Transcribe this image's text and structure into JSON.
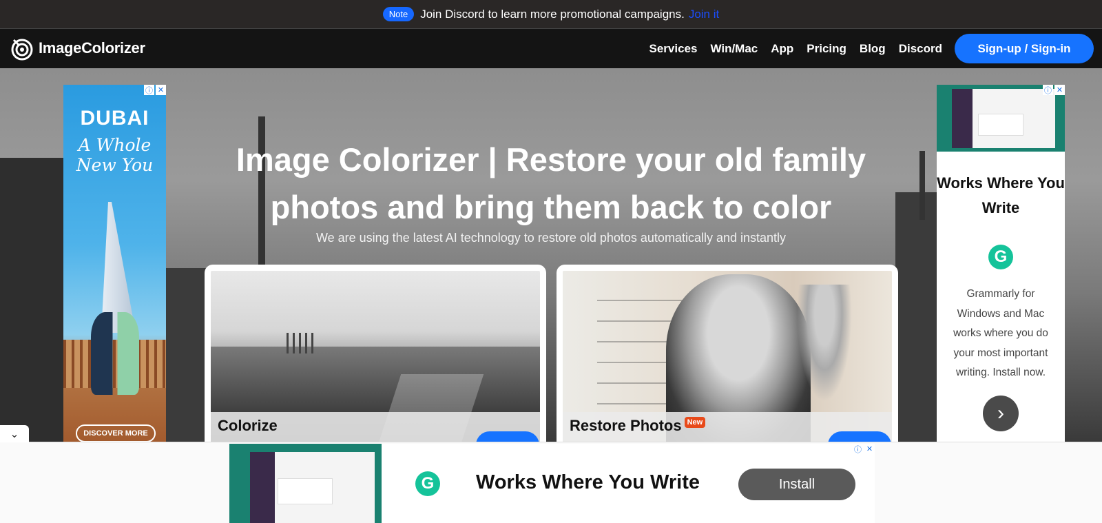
{
  "notice": {
    "badge": "Note",
    "text": "Join Discord to learn more promotional campaigns.",
    "link": "Join it"
  },
  "navbar": {
    "brand": "ImageColorizer",
    "links": [
      "Services",
      "Win/Mac",
      "App",
      "Pricing",
      "Blog",
      "Discord"
    ],
    "signin": "Sign-up / Sign-in"
  },
  "hero": {
    "title": "Image Colorizer | Restore your old family photos and bring them back to color",
    "subtitle": "We are using the latest AI technology to restore old photos automatically and instantly",
    "cards": [
      {
        "label": "Colorize",
        "badge": ""
      },
      {
        "label": "Restore Photos",
        "badge": "New"
      }
    ]
  },
  "ad_left": {
    "brand": "DUBAI",
    "tagline": "A Whole New You",
    "cta": "DISCOVER MORE"
  },
  "ad_right": {
    "title": "Works Where You Write",
    "body": "Grammarly for Windows and Mac works where you do your most important writing. Install now."
  },
  "ad_bottom": {
    "title": "Works Where You Write",
    "cta": "Install"
  },
  "colors": {
    "accent": "#1673ff",
    "badge_new": "#e84a1a",
    "grammarly": "#15c39a"
  }
}
